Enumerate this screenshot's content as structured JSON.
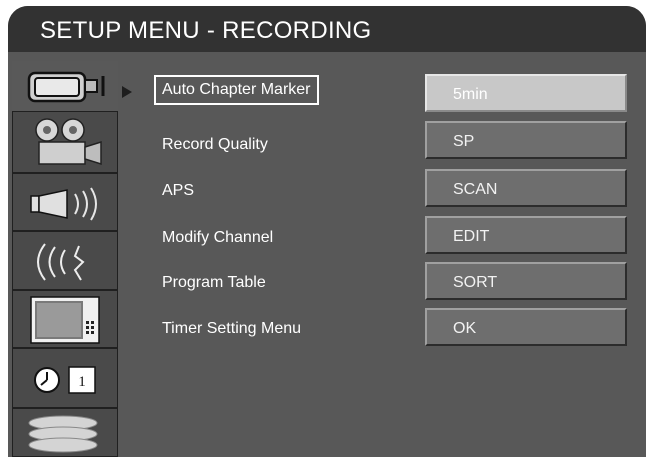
{
  "title": "SETUP MENU - RECORDING",
  "colors": {
    "title_bar": "#323232",
    "panel": "#585858",
    "value_box": "#6e6e6e",
    "value_box_selected": "#c8c8c8",
    "text": "#ffffff"
  },
  "sidebar": {
    "items": [
      {
        "icon": "camcorder-icon",
        "selected": true
      },
      {
        "icon": "video-camera-icon",
        "selected": false
      },
      {
        "icon": "speaker-icon",
        "selected": false
      },
      {
        "icon": "wireless-signal-icon",
        "selected": false
      },
      {
        "icon": "tv-icon",
        "selected": false
      },
      {
        "icon": "clock-icon",
        "label": "1",
        "selected": false
      },
      {
        "icon": "disc-stack-icon",
        "selected": false
      }
    ]
  },
  "menu": {
    "items": [
      {
        "label": "Auto Chapter Marker",
        "value": "5min",
        "selected": true
      },
      {
        "label": "Record Quality",
        "value": "SP",
        "selected": false
      },
      {
        "label": "APS",
        "value": "SCAN",
        "selected": false
      },
      {
        "label": "Modify Channel",
        "value": "EDIT",
        "selected": false
      },
      {
        "label": "Program Table",
        "value": "SORT",
        "selected": false
      },
      {
        "label": "Timer Setting Menu",
        "value": "OK",
        "selected": false
      }
    ]
  }
}
